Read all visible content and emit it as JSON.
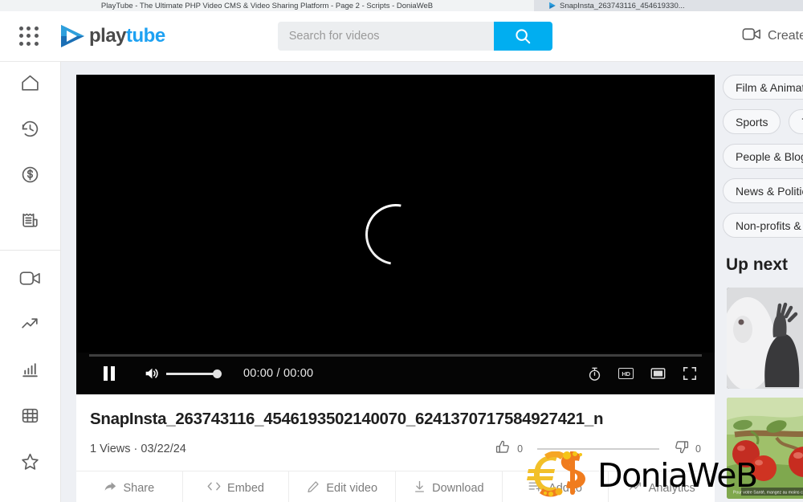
{
  "browser": {
    "tabs": [
      {
        "title": "PlayTube - The Ultimate PHP Video CMS & Video Sharing Platform - Page 2 - Scripts - DoniaWeB",
        "active": true
      },
      {
        "title": "SnapInsta_263743116_454619330...",
        "active": false
      }
    ]
  },
  "header": {
    "apps_icon": "apps-grid-icon",
    "logo": {
      "play": "play",
      "tube": "tube",
      "icon": "playtube-play-logo-icon"
    },
    "search": {
      "value": "",
      "placeholder": "Search for videos",
      "icon": "search-icon"
    },
    "create": {
      "label": "Create",
      "icon": "video-camera-icon"
    }
  },
  "sidebar": {
    "items": [
      {
        "icon": "home-icon",
        "name": "home"
      },
      {
        "icon": "history-clock-icon",
        "name": "history"
      },
      {
        "icon": "dollar-circle-icon",
        "name": "monetization"
      },
      {
        "icon": "receipt-icon",
        "name": "purchases"
      },
      {
        "icon": "video-camera-icon",
        "name": "my-videos"
      },
      {
        "icon": "trending-arrow-icon",
        "name": "trending"
      },
      {
        "icon": "bar-chart-icon",
        "name": "analytics"
      },
      {
        "icon": "film-grid-icon",
        "name": "movies"
      },
      {
        "icon": "star-icon",
        "name": "favorites"
      }
    ]
  },
  "player": {
    "state": "loading",
    "spinner": "loading-spinner-icon",
    "pause_icon": "pause-icon",
    "volume_icon": "volume-on-icon",
    "volume_level": 88,
    "progress": 0,
    "time": "00:00 / 00:00",
    "right_controls": [
      {
        "icon": "stopwatch-speed-icon",
        "name": "playback-speed"
      },
      {
        "icon": "hd-badge-icon",
        "name": "quality-hd",
        "label": "HD"
      },
      {
        "icon": "theater-mode-icon",
        "name": "theater-mode"
      },
      {
        "icon": "fullscreen-icon",
        "name": "fullscreen"
      }
    ]
  },
  "video": {
    "title": "SnapInsta_263743116_4546193502140070_6241370717584927421_n",
    "views": "1 Views",
    "separator": "·",
    "date": "03/22/24",
    "likes": "0",
    "dislikes": "0",
    "like_icon": "thumbs-up-icon",
    "dislike_icon": "thumbs-down-icon"
  },
  "actions": [
    {
      "label": "Share",
      "icon": "share-arrow-icon"
    },
    {
      "label": "Embed",
      "icon": "code-brackets-icon"
    },
    {
      "label": "Edit video",
      "icon": "pencil-icon"
    },
    {
      "label": "Download",
      "icon": "download-arrow-icon"
    },
    {
      "label": "Add to",
      "icon": "playlist-add-icon"
    },
    {
      "label": "Analytics",
      "icon": "trending-arrow-icon"
    }
  ],
  "right_panel": {
    "category_rows": [
      [
        "Film & Animation"
      ],
      [
        "Sports",
        "T"
      ],
      [
        "People & Blogs"
      ],
      [
        "News & Politics"
      ],
      [
        "Non-profits & Activism"
      ]
    ],
    "up_next_title": "Up next",
    "thumbnails": [
      {
        "name": "thumbnail-silhouette-hands"
      },
      {
        "name": "thumbnail-apples-on-tree"
      }
    ]
  },
  "watermark": {
    "text": "DoniaWeB",
    "euro": "€",
    "dollar": "$",
    "colors": {
      "euro": "#f5c518",
      "dollar": "#f07c1e",
      "text": "#5a1f1f"
    }
  },
  "colors": {
    "accent": "#01aef0",
    "logo_blue": "#1da1f2",
    "page_bg": "#eef0f4",
    "card_bg": "#ffffff",
    "player_bg": "#000000"
  }
}
